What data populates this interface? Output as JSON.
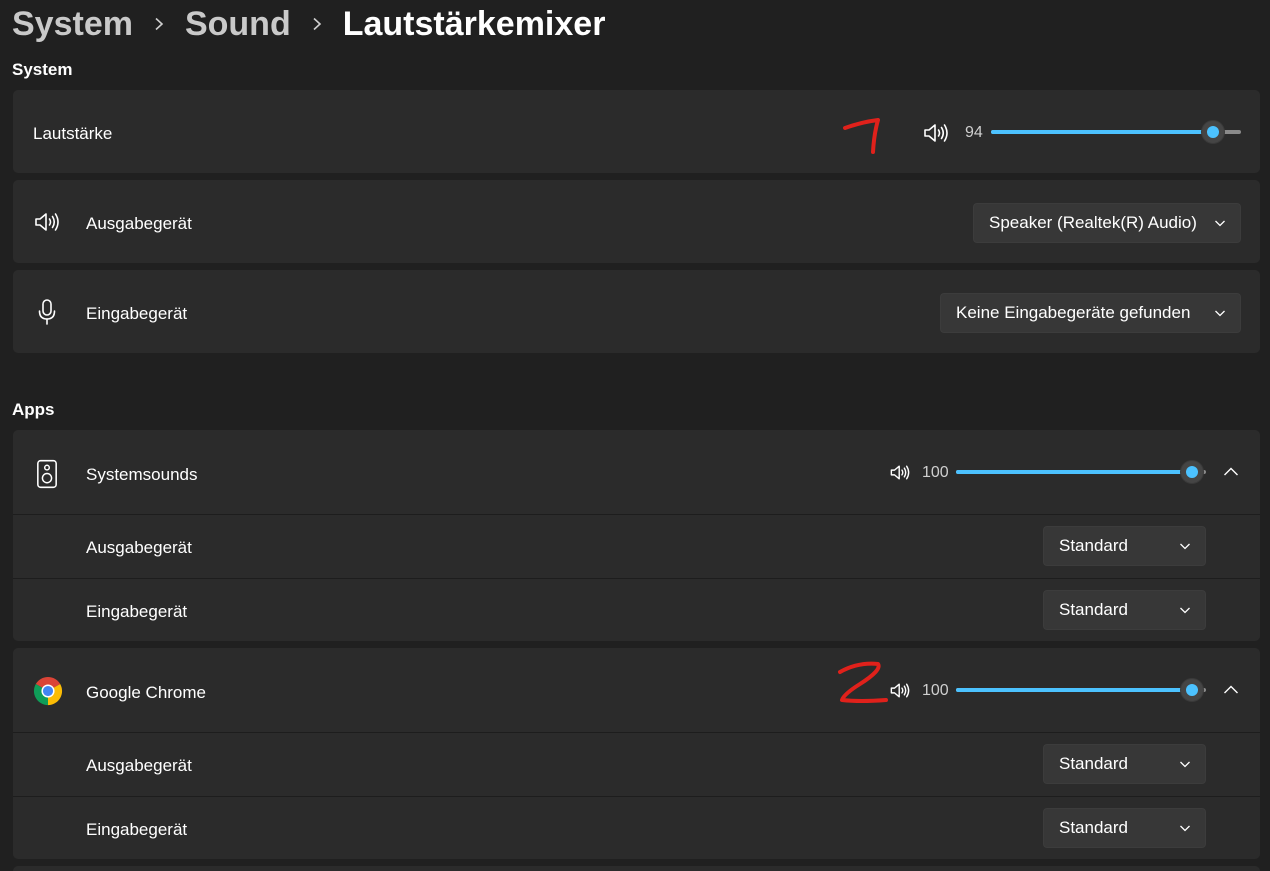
{
  "breadcrumb": {
    "level1": "System",
    "level2": "Sound",
    "current": "Lautstärkemixer"
  },
  "system_section": {
    "title": "System",
    "volume": {
      "label": "Lautstärke",
      "value": "94",
      "level": 0.94,
      "icon": "speaker-icon"
    },
    "output": {
      "label": "Ausgabegerät",
      "selected": "Speaker (Realtek(R) Audio)",
      "icon": "speaker-icon"
    },
    "input": {
      "label": "Eingabegerät",
      "selected": "Keine Eingabegeräte gefunden",
      "icon": "microphone-icon"
    }
  },
  "apps_section": {
    "title": "Apps",
    "apps": [
      {
        "name": "Systemsounds",
        "volume": "100",
        "level": 1.0,
        "icon": "system-sounds-icon",
        "output": {
          "label": "Ausgabegerät",
          "selected": "Standard"
        },
        "input": {
          "label": "Eingabegerät",
          "selected": "Standard"
        }
      },
      {
        "name": "Google Chrome",
        "volume": "100",
        "level": 1.0,
        "icon": "chrome-icon",
        "output": {
          "label": "Ausgabegerät",
          "selected": "Standard"
        },
        "input": {
          "label": "Eingabegerät",
          "selected": "Standard"
        }
      }
    ]
  },
  "annotations": {
    "mark1": "1",
    "mark2": "2",
    "color": "#e0211b"
  },
  "colors": {
    "accent": "#4cc2ff",
    "background": "#202020",
    "card": "#2b2b2b"
  }
}
